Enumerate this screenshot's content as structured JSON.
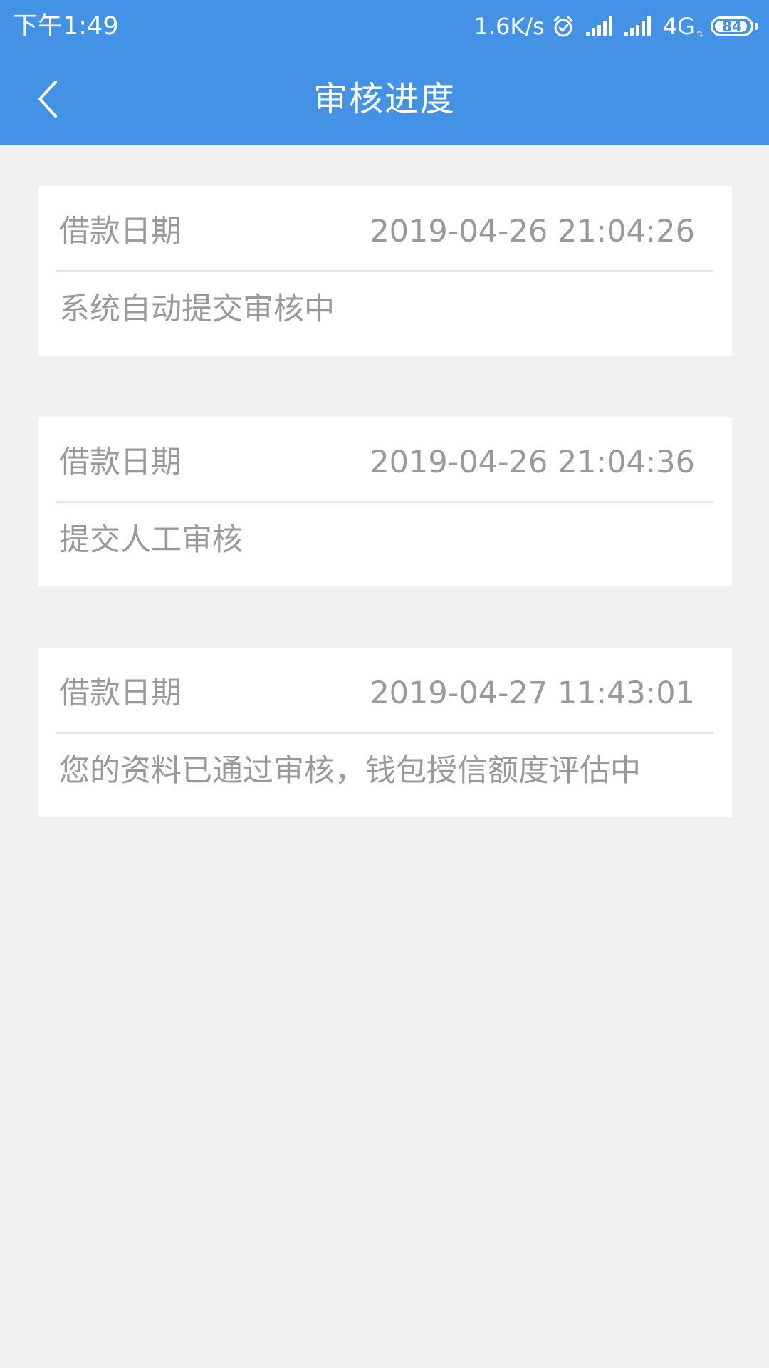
{
  "status_bar": {
    "time": "下午1:49",
    "net_speed": "1.6K/s",
    "network_type": "4G",
    "network_arrows": "⇅",
    "battery_level": "84",
    "icons": [
      "alarm-icon",
      "signal-icon",
      "signal-icon",
      "battery-icon"
    ]
  },
  "nav": {
    "title": "审核进度",
    "back_icon": "chevron-left-icon"
  },
  "records": [
    {
      "label": "借款日期",
      "date": "2019-04-26 21:04:26",
      "status": "系统自动提交审核中"
    },
    {
      "label": "借款日期",
      "date": "2019-04-26 21:04:36",
      "status": "提交人工审核"
    },
    {
      "label": "借款日期",
      "date": "2019-04-27 11:43:01",
      "status": "您的资料已通过审核，钱包授信额度评估中"
    }
  ],
  "colors": {
    "header_bg": "#4392e6",
    "page_bg": "#f1f1f1",
    "card_bg": "#ffffff",
    "text_muted": "#999999",
    "divider": "#e6e6e6"
  }
}
